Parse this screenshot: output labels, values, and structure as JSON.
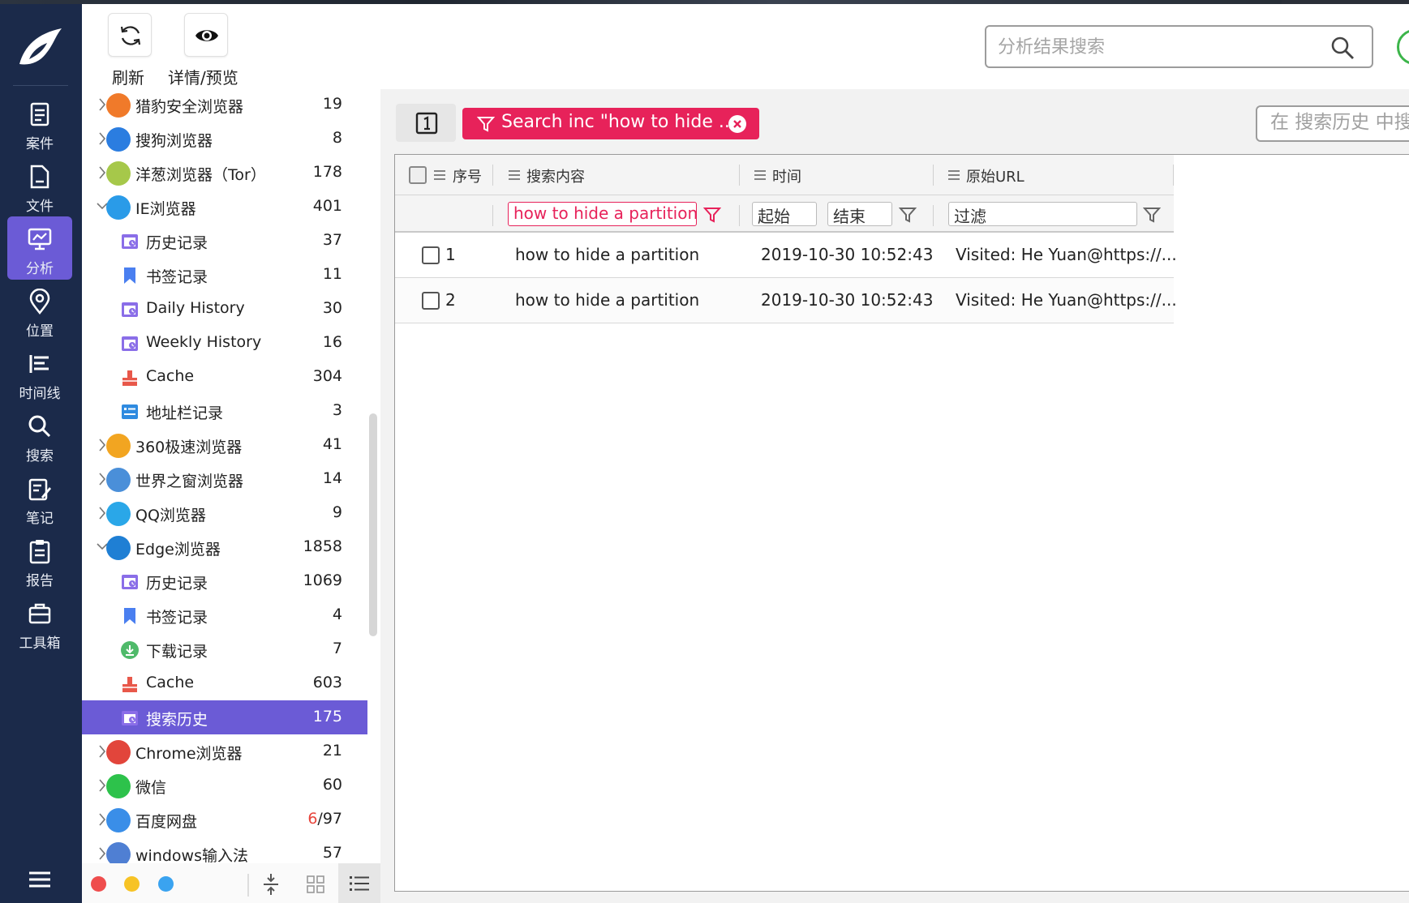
{
  "nav": {
    "items": [
      {
        "label": "案件",
        "icon": "case-icon"
      },
      {
        "label": "文件",
        "icon": "file-icon"
      },
      {
        "label": "分析",
        "icon": "analysis-icon",
        "active": true
      },
      {
        "label": "位置",
        "icon": "location-icon"
      },
      {
        "label": "时间线",
        "icon": "timeline-icon"
      },
      {
        "label": "搜索",
        "icon": "search-icon"
      },
      {
        "label": "笔记",
        "icon": "notes-icon"
      },
      {
        "label": "报告",
        "icon": "report-icon"
      },
      {
        "label": "工具箱",
        "icon": "toolbox-icon"
      }
    ]
  },
  "toolbar": {
    "refresh_label": "刷新",
    "preview_label": "详情/预览"
  },
  "top_search": {
    "placeholder": "分析结果搜索"
  },
  "tree": {
    "rows": [
      {
        "label": "猎豹安全浏览器",
        "count": "19",
        "level": 0,
        "expanded": false,
        "icon": "cheetah-browser-icon"
      },
      {
        "label": "搜狗浏览器",
        "count": "8",
        "level": 0,
        "expanded": false,
        "icon": "sogou-browser-icon"
      },
      {
        "label": "洋葱浏览器（Tor）",
        "count": "178",
        "level": 0,
        "expanded": false,
        "icon": "tor-browser-icon"
      },
      {
        "label": "IE浏览器",
        "count": "401",
        "level": 0,
        "expanded": true,
        "icon": "ie-browser-icon"
      },
      {
        "label": "历史记录",
        "count": "37",
        "level": 1,
        "icon": "history-icon"
      },
      {
        "label": "书签记录",
        "count": "11",
        "level": 1,
        "icon": "bookmark-icon"
      },
      {
        "label": "Daily History",
        "count": "30",
        "level": 1,
        "icon": "history-icon"
      },
      {
        "label": "Weekly History",
        "count": "16",
        "level": 1,
        "icon": "history-icon"
      },
      {
        "label": "Cache",
        "count": "304",
        "level": 1,
        "icon": "cache-icon"
      },
      {
        "label": "地址栏记录",
        "count": "3",
        "level": 1,
        "icon": "address-bar-icon"
      },
      {
        "label": "360极速浏览器",
        "count": "41",
        "level": 0,
        "expanded": false,
        "icon": "360-browser-icon"
      },
      {
        "label": "世界之窗浏览器",
        "count": "14",
        "level": 0,
        "expanded": false,
        "icon": "theworld-browser-icon"
      },
      {
        "label": "QQ浏览器",
        "count": "9",
        "level": 0,
        "expanded": false,
        "icon": "qq-browser-icon"
      },
      {
        "label": "Edge浏览器",
        "count": "1858",
        "level": 0,
        "expanded": true,
        "icon": "edge-browser-icon"
      },
      {
        "label": "历史记录",
        "count": "1069",
        "level": 1,
        "icon": "history-icon"
      },
      {
        "label": "书签记录",
        "count": "4",
        "level": 1,
        "icon": "bookmark-icon"
      },
      {
        "label": "下载记录",
        "count": "7",
        "level": 1,
        "icon": "download-icon"
      },
      {
        "label": "Cache",
        "count": "603",
        "level": 1,
        "icon": "cache-icon"
      },
      {
        "label": "搜索历史",
        "count": "175",
        "level": 1,
        "icon": "history-icon",
        "selected": true
      },
      {
        "label": "Chrome浏览器",
        "count": "21",
        "level": 0,
        "expanded": false,
        "icon": "chrome-browser-icon"
      },
      {
        "label": "微信",
        "count": "60",
        "level": 0,
        "expanded": false,
        "icon": "wechat-icon"
      },
      {
        "label": "百度网盘",
        "count_red": "6",
        "count_rest": "/97",
        "level": 0,
        "expanded": false,
        "icon": "baidu-netdisk-icon"
      },
      {
        "label": "windows输入法",
        "count": "57",
        "level": 0,
        "expanded": false,
        "icon": "keyboard-icon"
      }
    ]
  },
  "filter_chip": {
    "label": "Search inc \"how to hide ..."
  },
  "history_search": {
    "placeholder": "在 搜索历史 中搜索"
  },
  "grid": {
    "headers": {
      "seq": "序号",
      "content": "搜索内容",
      "time": "时间",
      "url": "原始URL"
    },
    "filters": {
      "content": "how to hide a partition",
      "start": "起始",
      "end": "结束",
      "url": "过滤"
    },
    "rows": [
      {
        "seq": "1",
        "content": "how to hide a partition",
        "time": "2019-10-30 10:52:43",
        "url": "Visited: He Yuan@https://..."
      },
      {
        "seq": "2",
        "content": "how to hide a partition",
        "time": "2019-10-30 10:52:43",
        "url": "Visited: He Yuan@https://..."
      }
    ]
  },
  "colors": {
    "nav_bg": "#1b2a4a",
    "accent": "#6b5bd6",
    "filter": "#e7225a",
    "status_ok": "#3cb54a"
  }
}
